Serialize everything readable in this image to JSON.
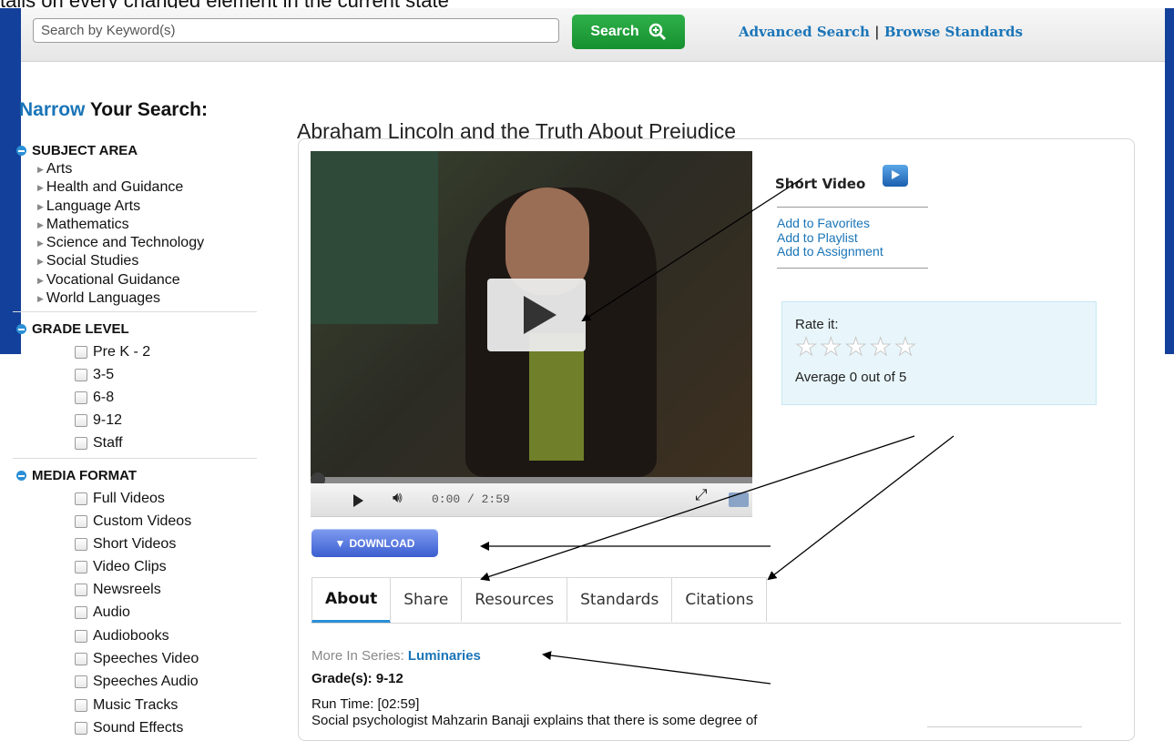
{
  "top_strip_text": "tails on every changed element in the current state",
  "search": {
    "placeholder": "Search by Keyword(s)",
    "button_label": "Search",
    "advanced_label": "Advanced Search",
    "separator": "|",
    "browse_label": "Browse Standards"
  },
  "sidebar": {
    "title_accent": "Narrow",
    "title_rest": " Your Search:",
    "subject_area": {
      "heading": "SUBJECT AREA",
      "items": [
        "Arts",
        "Health and Guidance",
        "Language Arts",
        "Mathematics",
        "Science and Technology",
        "Social Studies",
        "Vocational Guidance",
        "World Languages"
      ]
    },
    "grade_level": {
      "heading": "GRADE LEVEL",
      "items": [
        "Pre K - 2",
        "3-5",
        "6-8",
        "9-12",
        "Staff"
      ]
    },
    "media_format": {
      "heading": "MEDIA FORMAT",
      "items": [
        "Full Videos",
        "Custom Videos",
        "Short Videos",
        "Video Clips",
        "Newsreels",
        "Audio",
        "Audiobooks",
        "Speeches Video",
        "Speeches Audio",
        "Music Tracks",
        "Sound Effects"
      ]
    }
  },
  "video": {
    "title": "Abraham Lincoln and the Truth About Prejudice",
    "time_current": "0:00",
    "time_separator": " / ",
    "time_total": "2:59",
    "progress_fraction": 0,
    "download_label": "DOWNLOAD",
    "download_icon": "triangle-down-icon"
  },
  "side": {
    "type_label": "Short Video",
    "links": [
      "Add to Favorites",
      "Add to Playlist",
      "Add to Assignment"
    ],
    "rate_label": "Rate it:",
    "rating_value": 0,
    "rating_max": 5,
    "average_text": "Average 0 out of 5"
  },
  "tabs": [
    "About",
    "Share",
    "Resources",
    "Standards",
    "Citations"
  ],
  "active_tab": "About",
  "about": {
    "series_label": "More In Series: ",
    "series_name": "Luminaries",
    "grades": "Grade(s): 9-12",
    "runtime": "Run Time: [02:59]",
    "description": "Social psychologist Mahzarin Banaji explains that there is some degree of"
  },
  "colors": {
    "link_blue": "#1a75b8",
    "search_green": "#1fa03a",
    "download_blue": "#4a6ee0",
    "page_blue": "#13409a",
    "rate_bg": "#e8f6fb"
  }
}
